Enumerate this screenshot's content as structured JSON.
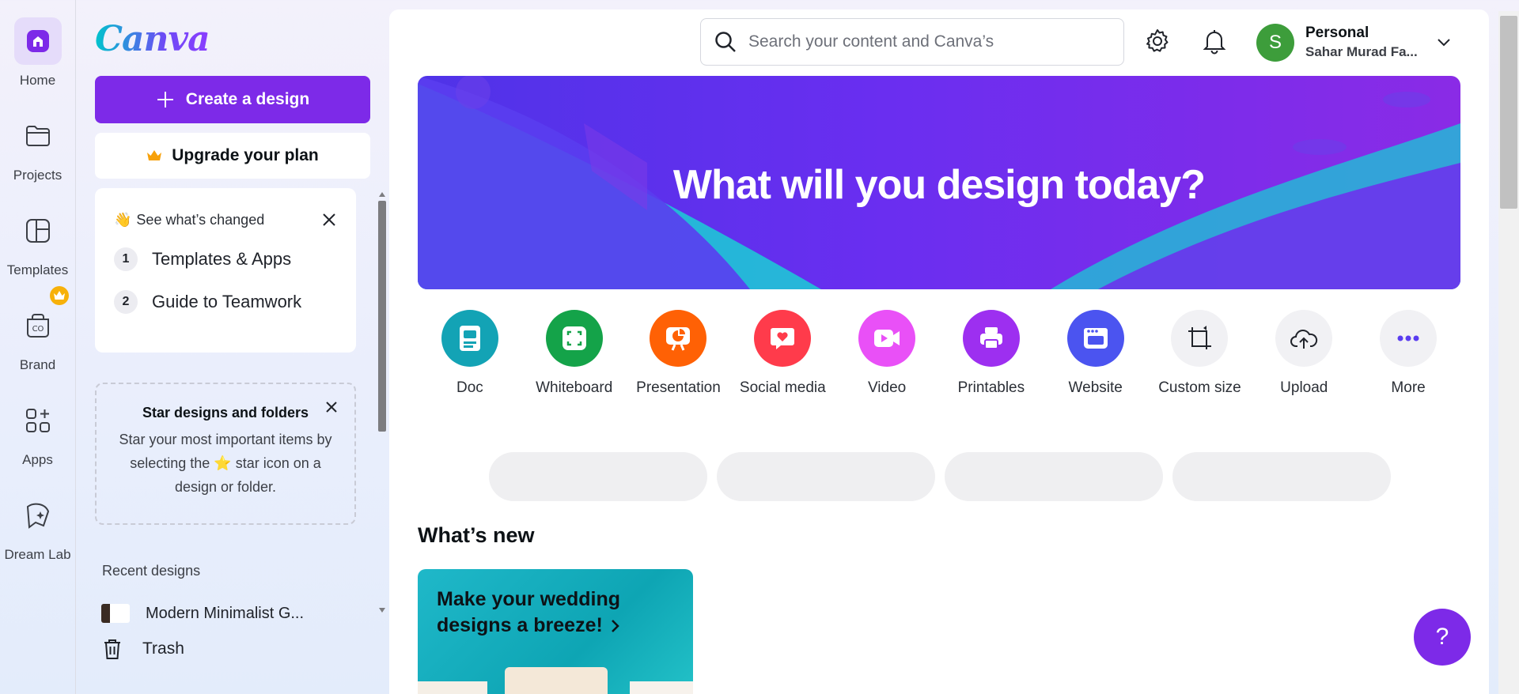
{
  "colors": {
    "brand_purple": "#7d2ae8",
    "hero_gradient": [
      "#4f33e8",
      "#8a2be6"
    ]
  },
  "rail": {
    "items": [
      {
        "label": "Home",
        "icon": "home-icon"
      },
      {
        "label": "Projects",
        "icon": "folder-icon"
      },
      {
        "label": "Templates",
        "icon": "templates-icon"
      },
      {
        "label": "Brand",
        "icon": "brand-icon"
      },
      {
        "label": "Apps",
        "icon": "apps-icon"
      },
      {
        "label": "Dream Lab",
        "icon": "dream-lab-icon"
      }
    ]
  },
  "sidebar": {
    "logo": "Canva",
    "create_label": "Create a design",
    "upgrade_label": "Upgrade your plan",
    "changed_card": {
      "title": "See what’s changed",
      "steps": [
        {
          "num": "1",
          "label": "Templates & Apps"
        },
        {
          "num": "2",
          "label": "Guide to Teamwork"
        }
      ]
    },
    "star_card": {
      "title": "Star designs and folders",
      "body_before": "Star your most important items by selecting the",
      "body_after": "star icon on a design or folder."
    },
    "recent_title": "Recent designs",
    "recent_items": [
      "Modern Minimalist G..."
    ],
    "trash_label": "Trash"
  },
  "header": {
    "search_placeholder": "Search your content and Canva’s",
    "account_name": "Personal",
    "account_sub": "Sahar Murad Fa...",
    "avatar_letter": "S"
  },
  "hero": {
    "title": "What will you design today?"
  },
  "categories": [
    {
      "label": "Doc",
      "color": "#13a3b5"
    },
    {
      "label": "Whiteboard",
      "color": "#14a349"
    },
    {
      "label": "Presentation",
      "color": "#ff6105"
    },
    {
      "label": "Social media",
      "color": "#ff3b4b"
    },
    {
      "label": "Video",
      "color": "#e950f7"
    },
    {
      "label": "Printables",
      "color": "#9d2ff0"
    },
    {
      "label": "Website",
      "color": "#4b54f0"
    },
    {
      "label": "Custom size",
      "color": "#f1f1f4"
    },
    {
      "label": "Upload",
      "color": "#f1f1f4"
    },
    {
      "label": "More",
      "color": "#f1f1f4"
    }
  ],
  "whats_new": {
    "title": "What’s new",
    "promo_line1": "Make your wedding",
    "promo_line2": "designs a breeze!"
  },
  "help": {
    "label": "?"
  }
}
